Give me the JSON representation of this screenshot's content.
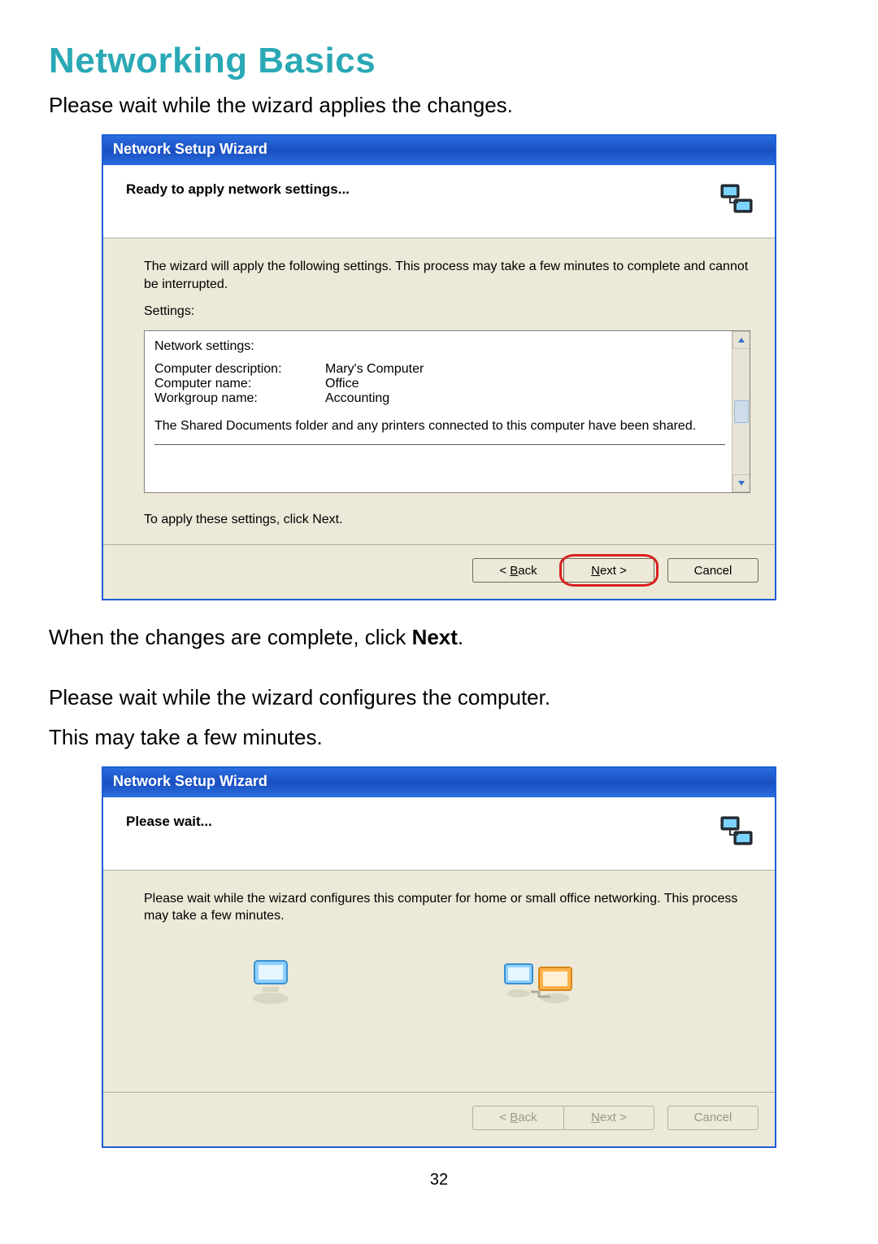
{
  "page": {
    "title": "Networking Basics",
    "intro1": "Please wait while the wizard applies the changes.",
    "after1_prefix": "When the changes are complete, click ",
    "after1_bold": "Next",
    "after1_suffix": ".",
    "intro2a": "Please wait while the wizard configures the computer.",
    "intro2b": "This may take a few minutes.",
    "page_number": "32"
  },
  "wizard1": {
    "title": "Network Setup Wizard",
    "header": "Ready to apply network settings...",
    "desc": "The wizard will apply the following settings. This process may take a few minutes to complete and cannot be interrupted.",
    "settings_label": "Settings:",
    "panel": {
      "head": "Network settings:",
      "rows": [
        {
          "k": "Computer description:",
          "v": "Mary's Computer"
        },
        {
          "k": "Computer name:",
          "v": "Office"
        },
        {
          "k": "Workgroup name:",
          "v": "Accounting"
        }
      ],
      "shared_note": "The Shared Documents folder and any printers connected to this computer have been shared."
    },
    "apply_hint": "To apply these settings, click Next.",
    "buttons": {
      "back_prefix": "< ",
      "back_u": "B",
      "back_rest": "ack",
      "next_u": "N",
      "next_rest": "ext >",
      "cancel": "Cancel"
    }
  },
  "wizard2": {
    "title": "Network Setup Wizard",
    "header": "Please wait...",
    "desc": "Please wait while the wizard configures this computer for home or small office networking. This process may take a few minutes.",
    "buttons": {
      "back_prefix": "< ",
      "back_u": "B",
      "back_rest": "ack",
      "next_u": "N",
      "next_rest": "ext >",
      "cancel": "Cancel"
    }
  }
}
